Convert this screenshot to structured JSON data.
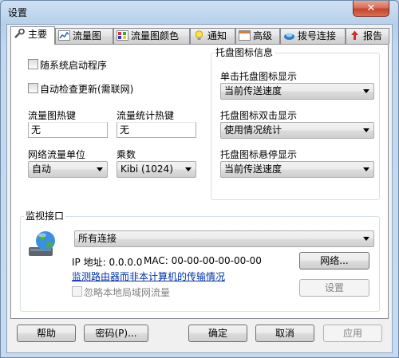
{
  "window": {
    "title": "设置",
    "close_glyph": "✕"
  },
  "tabs": [
    {
      "label": "主要",
      "icon": "wrench-icon"
    },
    {
      "label": "流量图",
      "icon": "graph-icon"
    },
    {
      "label": "流量图颜色",
      "icon": "palette-icon"
    },
    {
      "label": "通知",
      "icon": "bulb-icon"
    },
    {
      "label": "高级",
      "icon": "window-icon"
    },
    {
      "label": "拨号连接",
      "icon": "dialup-icon"
    },
    {
      "label": "报告",
      "icon": "report-icon"
    }
  ],
  "main": {
    "startup_label": "随系统启动程序",
    "auto_update_label": "自动检查更新(需联网)",
    "graph_hotkey_label": "流量图热键",
    "graph_hotkey_value": "无",
    "stats_hotkey_label": "流量统计热键",
    "stats_hotkey_value": "无",
    "traffic_unit_label": "网络流量单位",
    "traffic_unit_value": "自动",
    "multiplier_label": "乘数",
    "multiplier_value": "Kibi (1024)"
  },
  "tray": {
    "title": "托盘图标信息",
    "single_click_label": "单击托盘图标显示",
    "single_click_value": "当前传送速度",
    "double_click_label": "托盘图标双击显示",
    "double_click_value": "使用情况统计",
    "hover_label": "托盘图标悬停显示",
    "hover_value": "当前传送速度"
  },
  "monitor": {
    "title": "监视接口",
    "interface_value": "所有连接",
    "ip_text": "IP 地址: 0.0.0.0",
    "mac_text": "MAC: 00-00-00-00-00-00",
    "router_link": "监测路由器而非本计算机的传输情况",
    "ignore_lan_label": "忽略本地局域网流量",
    "network_button": "网络...",
    "settings_button": "设置",
    "icon": "network-globe-icon"
  },
  "footer": {
    "help": "帮助",
    "password": "密码(P)...",
    "ok": "确定",
    "cancel": "取消",
    "apply": "应用"
  }
}
